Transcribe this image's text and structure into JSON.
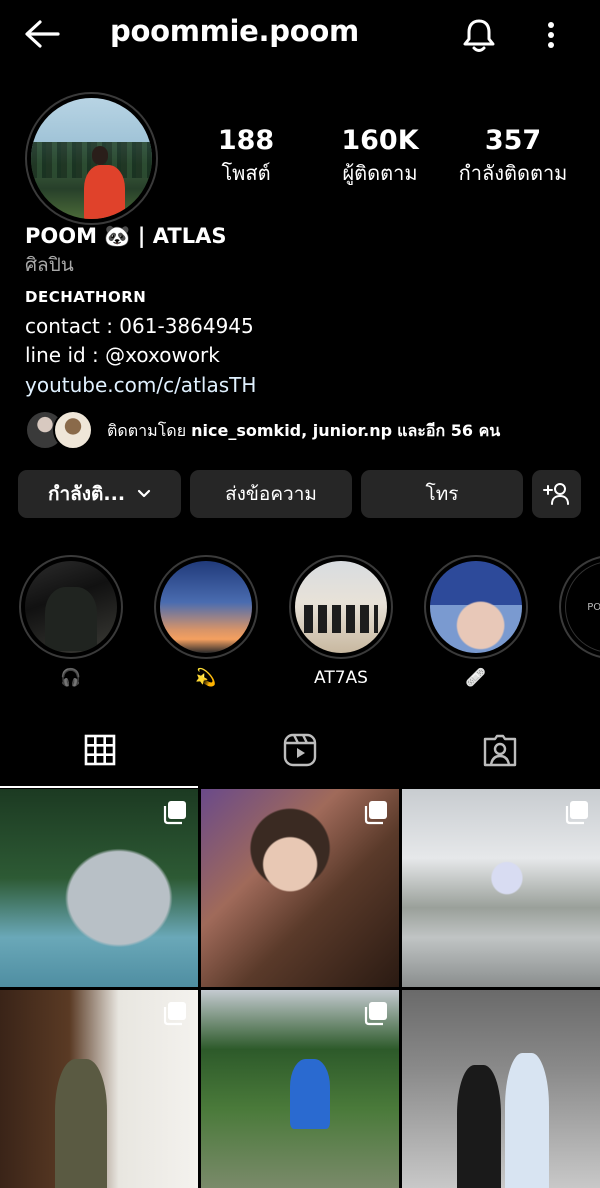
{
  "header": {
    "username": "poommie.poom"
  },
  "stats": [
    {
      "value": "188",
      "label": "โพสต์"
    },
    {
      "value": "160K",
      "label": "ผู้ติดตาม"
    },
    {
      "value": "357",
      "label": "กำลังติดตาม"
    }
  ],
  "bio": {
    "name": "POOM 🐼 | ATLAS",
    "category": "ศิลปิน",
    "subhead": "DECHATHORN",
    "contact": "contact : 061-3864945",
    "line_id": "line id : @xoxowork",
    "link": "youtube.com/c/atlasTH"
  },
  "followed_by": {
    "prefix": "ติดตามโดย",
    "names": "nice_somkid, junior.np",
    "suffix": "และอีก 56 คน"
  },
  "actions": {
    "following_label": "กำลังติ...",
    "message_label": "ส่งข้อความ",
    "call_label": "โทร"
  },
  "highlights": [
    {
      "caption": "🎧"
    },
    {
      "caption": "💫"
    },
    {
      "caption": "AT7AS"
    },
    {
      "caption": "🩹"
    },
    {
      "caption": "",
      "cover_text": "POOM DE"
    }
  ],
  "tabs": [
    {
      "icon": "grid-icon",
      "active": true
    },
    {
      "icon": "reels-icon",
      "active": false
    },
    {
      "icon": "tagged-icon",
      "active": false
    }
  ],
  "colors": {
    "background": "#000000",
    "button_bg": "#262626",
    "muted_text": "#a8a8a8",
    "link": "#e0f1ff"
  }
}
